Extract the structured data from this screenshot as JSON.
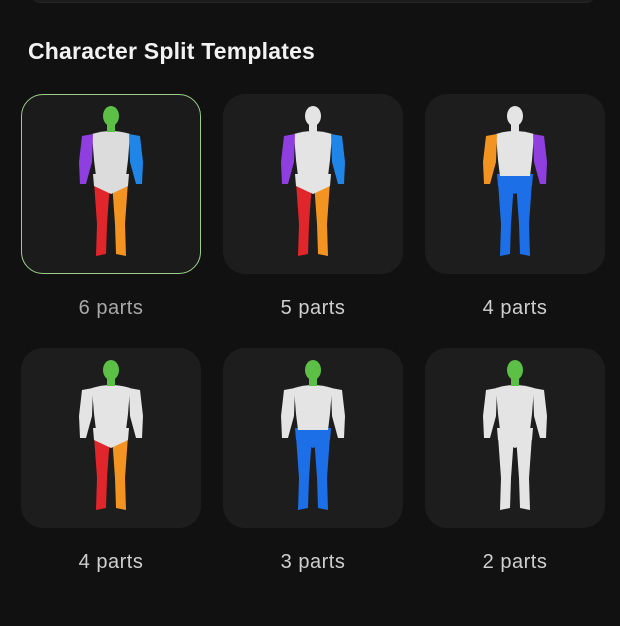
{
  "panel": {
    "title": "Character Split Templates"
  },
  "colors": {
    "background": "#111111",
    "card": "#1d1d1d",
    "selected_border": "#9ccf8c",
    "head_green": "#5cc046",
    "arm_purple": "#8f3fe0",
    "arm_blue": "#1f86e8",
    "leg_red": "#e0262b",
    "leg_orange": "#f39422",
    "legs_blue": "#1c6fe6",
    "body_white": "#e4e4e4"
  },
  "templates": [
    {
      "label": "6 parts",
      "selected": true,
      "icon": "mannequin-6-parts-icon",
      "colors": {
        "head": "#5cc046",
        "torso": "#dcdcdc",
        "left_arm": "#8f3fe0",
        "right_arm": "#1f86e8",
        "left_leg": "#e0262b",
        "right_leg": "#f39422",
        "pelvis": "#dcdcdc"
      }
    },
    {
      "label": "5 parts",
      "selected": false,
      "icon": "mannequin-5-parts-icon",
      "colors": {
        "head": "#e4e4e4",
        "torso": "#e4e4e4",
        "left_arm": "#8f3fe0",
        "right_arm": "#1f86e8",
        "left_leg": "#e0262b",
        "right_leg": "#f39422",
        "pelvis": "#e4e4e4"
      }
    },
    {
      "label": "4 parts",
      "selected": false,
      "icon": "mannequin-4-parts-arms-icon",
      "colors": {
        "head": "#e4e4e4",
        "torso": "#e4e4e4",
        "left_arm": "#f39422",
        "right_arm": "#8f3fe0",
        "left_leg": "#1c6fe6",
        "right_leg": "#1c6fe6",
        "pelvis": "#1c6fe6"
      }
    },
    {
      "label": "4 parts",
      "selected": false,
      "icon": "mannequin-4-parts-legs-icon",
      "colors": {
        "head": "#5cc046",
        "torso": "#e4e4e4",
        "left_arm": "#e4e4e4",
        "right_arm": "#e4e4e4",
        "left_leg": "#e0262b",
        "right_leg": "#f39422",
        "pelvis": "#e4e4e4"
      }
    },
    {
      "label": "3 parts",
      "selected": false,
      "icon": "mannequin-3-parts-icon",
      "colors": {
        "head": "#5cc046",
        "torso": "#e4e4e4",
        "left_arm": "#e4e4e4",
        "right_arm": "#e4e4e4",
        "left_leg": "#1c6fe6",
        "right_leg": "#1c6fe6",
        "pelvis": "#1c6fe6"
      }
    },
    {
      "label": "2 parts",
      "selected": false,
      "icon": "mannequin-2-parts-icon",
      "colors": {
        "head": "#5cc046",
        "torso": "#e4e4e4",
        "left_arm": "#e4e4e4",
        "right_arm": "#e4e4e4",
        "left_leg": "#e4e4e4",
        "right_leg": "#e4e4e4",
        "pelvis": "#e4e4e4"
      }
    }
  ]
}
